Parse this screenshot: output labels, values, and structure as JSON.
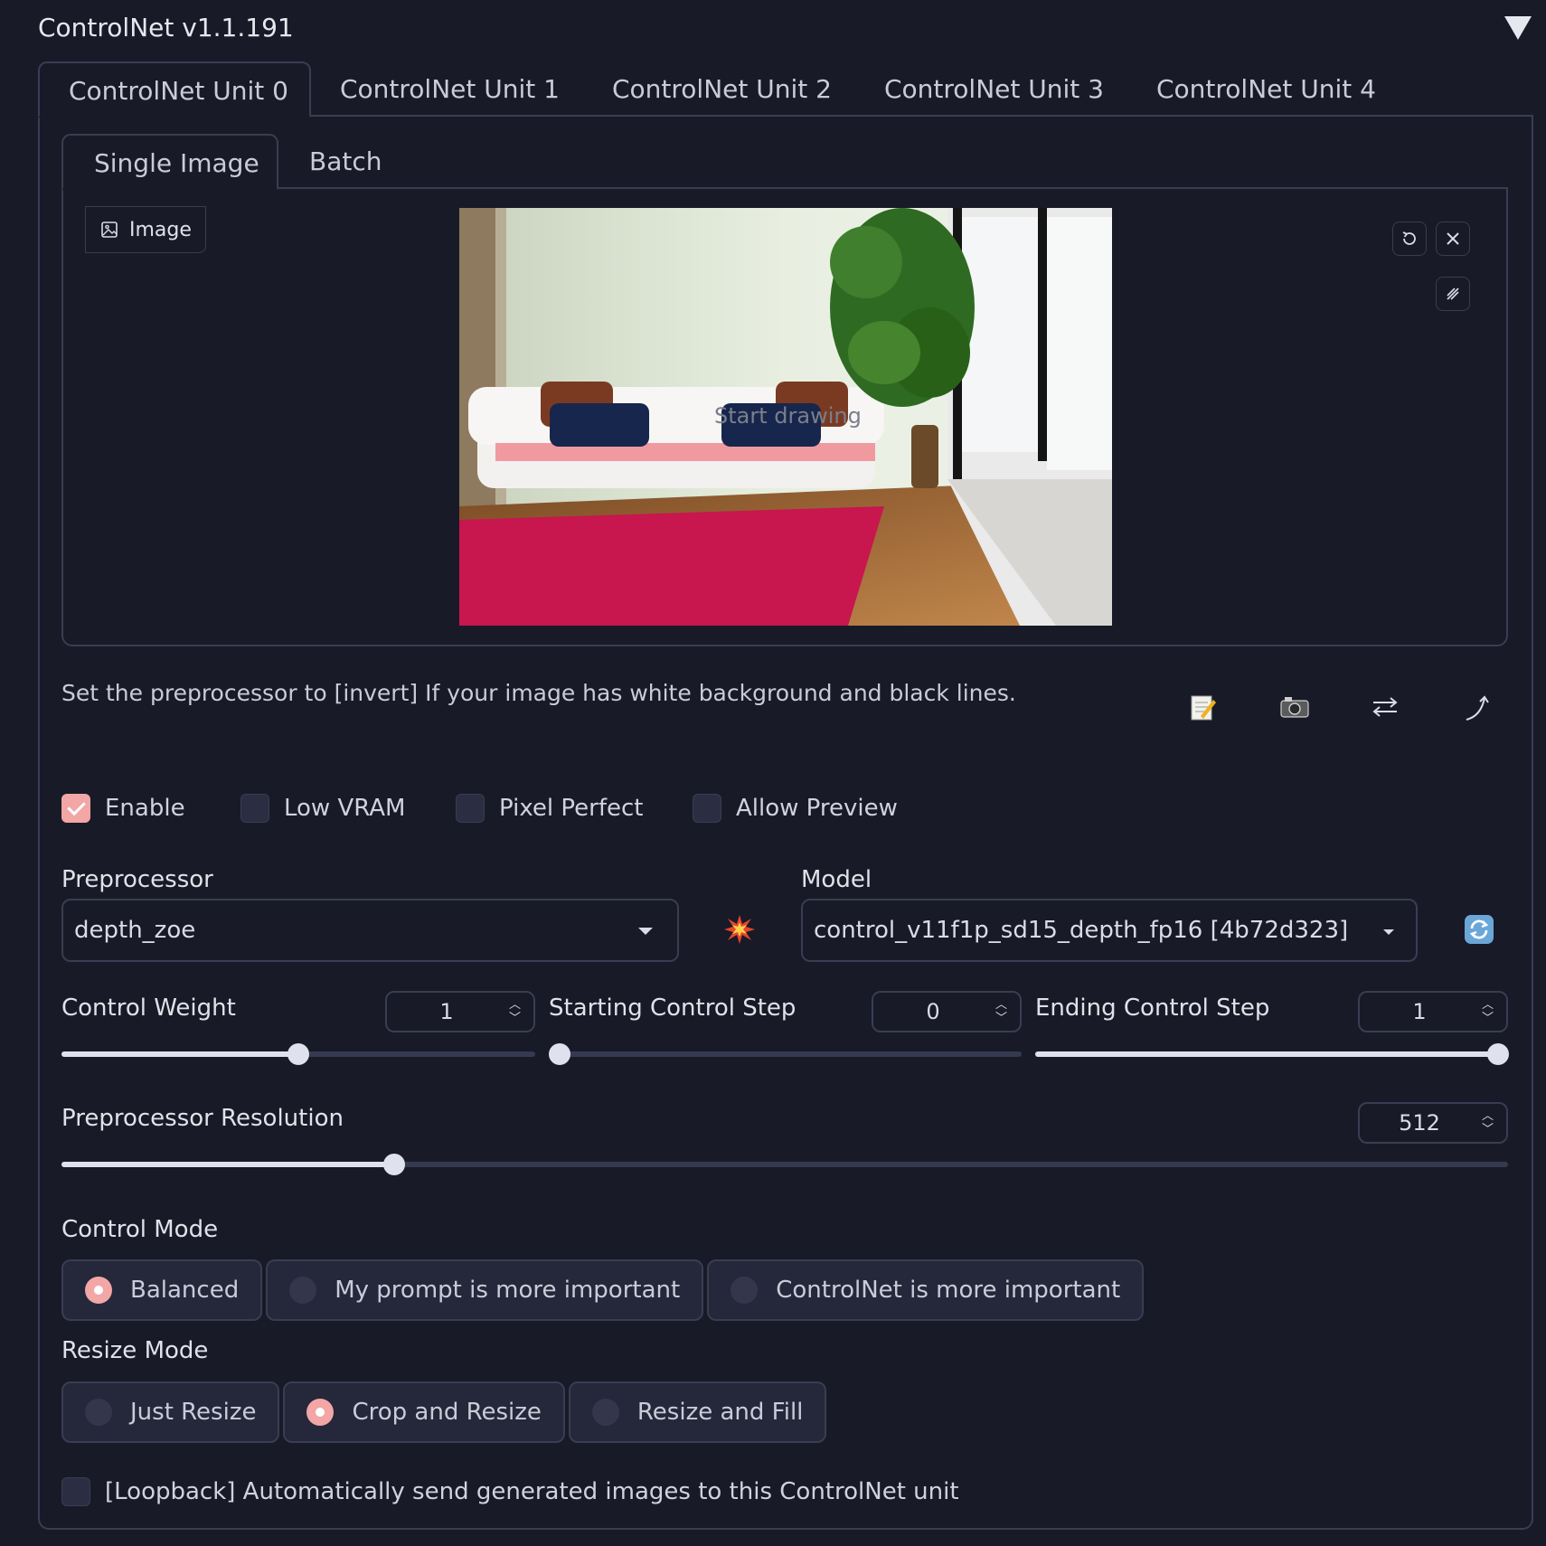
{
  "accordion": {
    "title": "ControlNet v1.1.191"
  },
  "unit_tabs": [
    "ControlNet Unit 0",
    "ControlNet Unit 1",
    "ControlNet Unit 2",
    "ControlNet Unit 3",
    "ControlNet Unit 4"
  ],
  "active_unit_tab": 0,
  "input_tabs": [
    "Single Image",
    "Batch"
  ],
  "image_panel": {
    "label": "Image",
    "canvas_hint": "Start drawing"
  },
  "hint_text": "Set the preprocessor to [invert] If your image has white background and black lines.",
  "checkboxes": {
    "enable": {
      "label": "Enable",
      "checked": true
    },
    "low_vram": {
      "label": "Low VRAM",
      "checked": false
    },
    "pixel_perfect": {
      "label": "Pixel Perfect",
      "checked": false
    },
    "allow_preview": {
      "label": "Allow Preview",
      "checked": false
    }
  },
  "preprocessor": {
    "label": "Preprocessor",
    "value": "depth_zoe"
  },
  "model": {
    "label": "Model",
    "value": "control_v11f1p_sd15_depth_fp16 [4b72d323]"
  },
  "control_weight": {
    "label": "Control Weight",
    "value": "1",
    "fraction": 0.5
  },
  "starting_step": {
    "label": "Starting Control Step",
    "value": "0",
    "fraction": 0.0
  },
  "ending_step": {
    "label": "Ending Control Step",
    "value": "1",
    "fraction": 1.0
  },
  "preprocessor_resolution": {
    "label": "Preprocessor Resolution",
    "value": "512",
    "fraction": 0.23
  },
  "control_mode": {
    "label": "Control Mode",
    "options": [
      "Balanced",
      "My prompt is more important",
      "ControlNet is more important"
    ],
    "selected": 0
  },
  "resize_mode": {
    "label": "Resize Mode",
    "options": [
      "Just Resize",
      "Crop and Resize",
      "Resize and Fill"
    ],
    "selected": 1
  },
  "loopback": {
    "label": "[Loopback] Automatically send generated images to this ControlNet unit",
    "checked": false
  },
  "colors": {
    "accent": "#f2a6a6",
    "background": "#181a27",
    "border": "#3a3d52"
  }
}
